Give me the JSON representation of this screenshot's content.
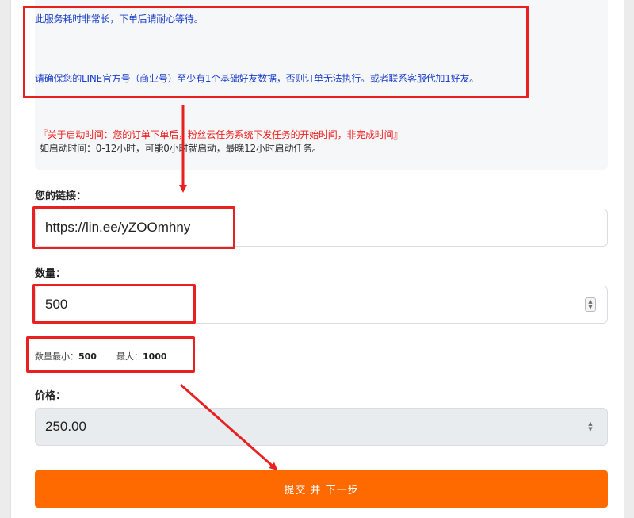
{
  "notice": {
    "line1": "此服务耗时非常长，下单后请耐心等待。",
    "line2": "请确保您的LINE官方号（商业号）至少有1个基础好友数据，否则订单无法执行。或者联系客服代加1好友。",
    "line3": "『关于启动时间：您的订单下单后，粉丝云任务系统下发任务的开始时间，非完成时间』",
    "line4": "如启动时间：0-12小时，可能0小时就启动，最晚12小时启动任务。"
  },
  "link": {
    "label": "您的链接：",
    "value": "https://lin.ee/yZOOmhny"
  },
  "quantity": {
    "label": "数量：",
    "value": "500",
    "min_label": "数量最小：",
    "min_value": "500",
    "max_label": "最大：",
    "max_value": "1000"
  },
  "price": {
    "label": "价格：",
    "value": "250.00"
  },
  "submit": {
    "label": "提交 并 下一步"
  },
  "colors": {
    "accent": "#ff6a00",
    "annotation_red": "#e82020",
    "notice_blue": "#1a3ec9"
  }
}
